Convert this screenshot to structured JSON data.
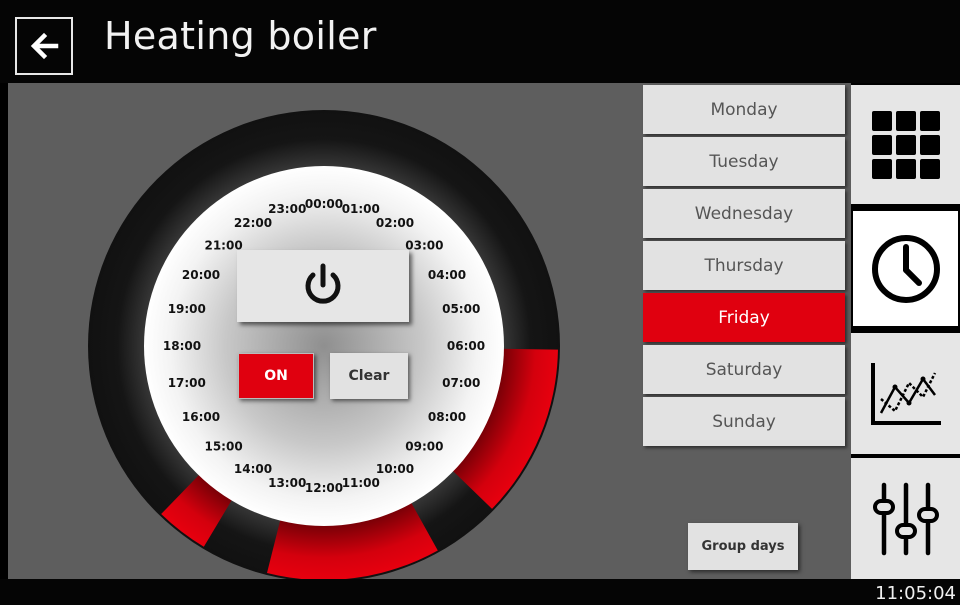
{
  "header": {
    "title": "Heating boiler",
    "back_icon": "arrow-left-icon"
  },
  "schedule": {
    "hours": [
      "00:00",
      "01:00",
      "02:00",
      "03:00",
      "04:00",
      "05:00",
      "06:00",
      "07:00",
      "08:00",
      "09:00",
      "10:00",
      "11:00",
      "12:00",
      "13:00",
      "14:00",
      "15:00",
      "16:00",
      "17:00",
      "18:00",
      "19:00",
      "20:00",
      "21:00",
      "22:00",
      "23:00"
    ],
    "active_ranges": [
      {
        "start": "06:00",
        "end": "09:00"
      },
      {
        "start": "10:00",
        "end": "13:00"
      },
      {
        "start": "14:00",
        "end": "15:00"
      }
    ],
    "active_color": "#e0000f"
  },
  "controls": {
    "power_icon": "power-icon",
    "on_label": "ON",
    "clear_label": "Clear",
    "group_days_label": "Group days"
  },
  "days": [
    {
      "label": "Monday",
      "active": false
    },
    {
      "label": "Tuesday",
      "active": false
    },
    {
      "label": "Wednesday",
      "active": false
    },
    {
      "label": "Thursday",
      "active": false
    },
    {
      "label": "Friday",
      "active": true
    },
    {
      "label": "Saturday",
      "active": false
    },
    {
      "label": "Sunday",
      "active": false
    }
  ],
  "sidebar": [
    {
      "icon": "grid-icon",
      "active": false
    },
    {
      "icon": "clock-icon",
      "active": true
    },
    {
      "icon": "chart-icon",
      "active": false
    },
    {
      "icon": "sliders-icon",
      "active": false
    }
  ],
  "footer": {
    "time": "11:05:04"
  }
}
